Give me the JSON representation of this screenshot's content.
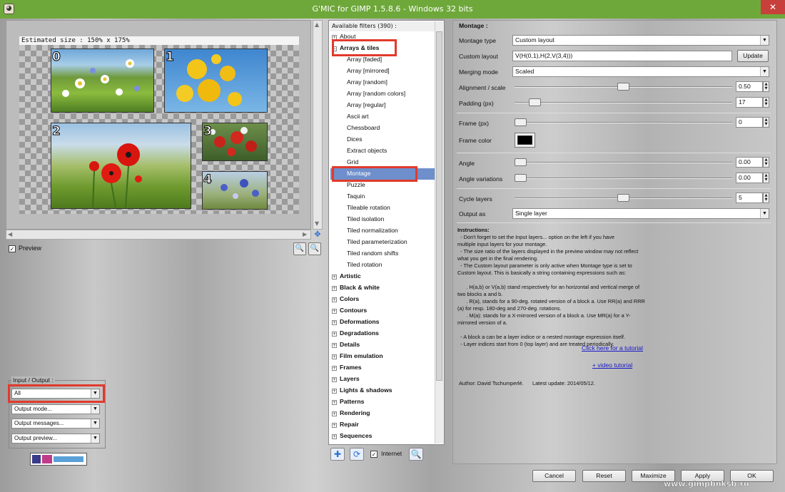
{
  "window": {
    "title": "G'MIC for GIMP 1.5.8.6 - Windows 32 bits",
    "close": "✕",
    "app_icon": "gimp-icon"
  },
  "preview": {
    "estimated_size": "Estimated size : 150% x 175%",
    "tile_numbers": [
      "0",
      "1",
      "2",
      "3",
      "4"
    ],
    "preview_label": "Preview",
    "preview_checked": true
  },
  "io": {
    "label": "Input / Output :",
    "input": "All",
    "output_mode": "Output mode...",
    "output_messages": "Output messages...",
    "output_preview": "Output preview..."
  },
  "filters": {
    "header": "Available filters (390) :",
    "about": "About",
    "open_category": "Arrays & tiles",
    "open_items": [
      "Array [faded]",
      "Array [mirrored]",
      "Array [random]",
      "Array [random colors]",
      "Array [regular]",
      "Ascii art",
      "Chessboard",
      "Dices",
      "Extract objects",
      "Grid",
      "Montage",
      "Puzzle",
      "Taquin",
      "Tileable rotation",
      "Tiled isolation",
      "Tiled normalization",
      "Tiled parameterization",
      "Tiled random shifts",
      "Tiled rotation"
    ],
    "selected": "Montage",
    "categories": [
      "Artistic",
      "Black & white",
      "Colors",
      "Contours",
      "Deformations",
      "Degradations",
      "Details",
      "Film emulation",
      "Frames",
      "Layers",
      "Lights & shadows",
      "Patterns",
      "Rendering",
      "Repair",
      "Sequences"
    ],
    "internet_label": "Internet",
    "internet_checked": true
  },
  "params": {
    "section": "Montage :",
    "montage_type_label": "Montage type",
    "montage_type": "Custom layout",
    "custom_layout_label": "Custom layout",
    "custom_layout": "V(H(0,1),H(2,V(3,4)))",
    "update": "Update",
    "merging_mode_label": "Merging mode",
    "merging_mode": "Scaled",
    "alignment_label": "Alignment / scale",
    "alignment": "0.50",
    "alignment_level": 0.5,
    "padding_label": "Padding (px)",
    "padding": "17",
    "padding_level": 0.07,
    "frame_label": "Frame (px)",
    "frame": "0",
    "frame_color_label": "Frame color",
    "frame_color": "#000000",
    "angle_label": "Angle",
    "angle": "0.00",
    "angle_var_label": "Angle variations",
    "angle_var": "0.00",
    "cycle_label": "Cycle layers",
    "cycle": "5",
    "cycle_level": 0.5,
    "output_as_label": "Output as",
    "output_as": "Single layer"
  },
  "instructions": {
    "title": "Instructions:",
    "lines": [
      "  - Don't forget to set the Input layers... option on the left if you have",
      "multiple input layers for your montage.",
      "  - The size ratio of the layers displayed in the preview window may not reflect",
      "what you get in the final rendering.",
      "  - The Custom layout parameter is only active when Montage type is set to",
      "Custom layout. This is basically a string containing expressions such as:",
      "",
      "      . H(a,b) or V(a,b) stand respectively for an horizontal and vertical merge of",
      "two blocks a and b.",
      "      . R(a), stands for a 90-deg. rotated version of a block a. Use RR(a) and RRR",
      "(a) for resp. 180-deg and 270-deg. rotations.",
      "      . M(a): stands for a X-mirrored version of a block a. Use MR(a) for a Y-",
      "mirrored version of a.",
      "",
      "  - A block a can be a layer indice or a nested montage expression itself.",
      "  - Layer indices start from 0 (top layer) and are treated periodically."
    ],
    "tutorial_link": "Click here for a tutorial",
    "video_link": "+ video tutorial",
    "author": "Author: David Tschumperlé.      Latest update: 2014/05/12."
  },
  "buttons": {
    "cancel": "Cancel",
    "reset": "Reset",
    "maximize": "Maximize",
    "apply": "Apply",
    "ok": "OK"
  },
  "watermark": "www.gimpbnksb.ru",
  "colors": {
    "titlebar": "#6ea83a",
    "selection": "#6e8fcb",
    "highlight_box": "#e23a2c",
    "close": "#c7403b"
  }
}
